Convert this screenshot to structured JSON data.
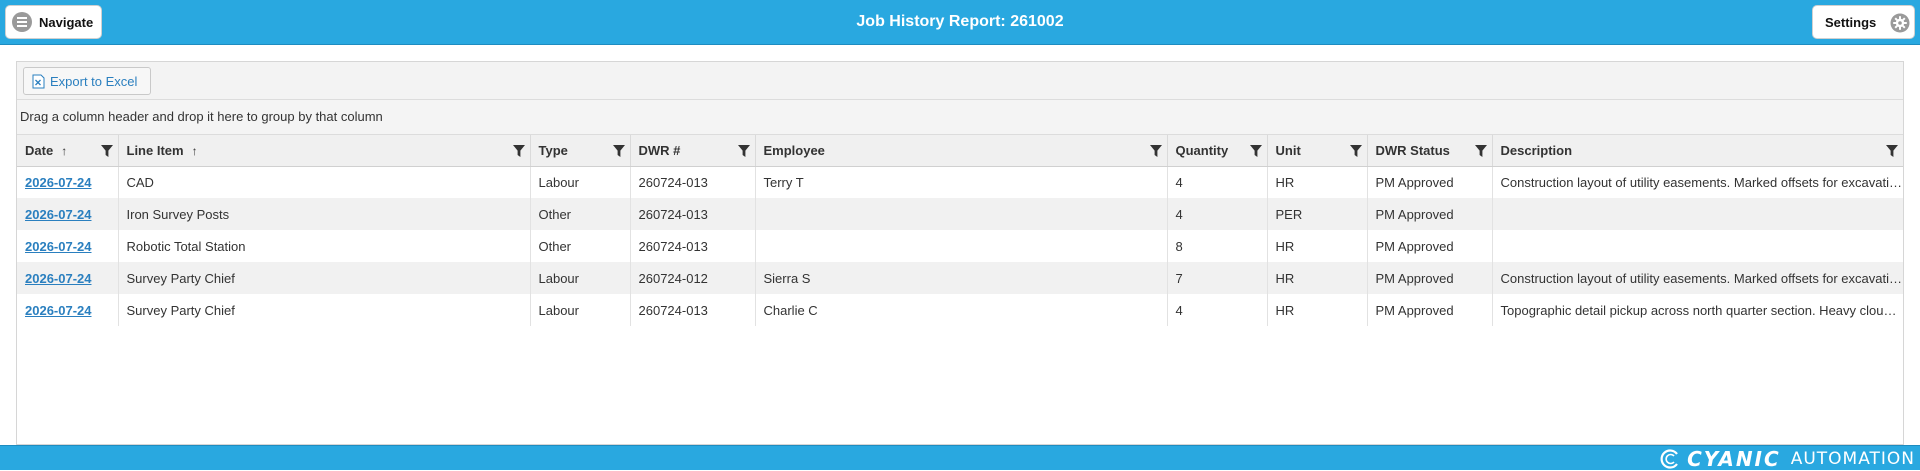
{
  "header": {
    "title": "Job History Report: 261002",
    "navigate_label": "Navigate",
    "settings_label": "Settings"
  },
  "toolbar": {
    "export_label": "Export to Excel"
  },
  "group_hint": "Drag a column header and drop it here to group by that column",
  "columns": [
    {
      "label": "Date",
      "sorted": "asc"
    },
    {
      "label": "Line Item",
      "sorted": "asc"
    },
    {
      "label": "Type"
    },
    {
      "label": "DWR #"
    },
    {
      "label": "Employee"
    },
    {
      "label": "Quantity"
    },
    {
      "label": "Unit"
    },
    {
      "label": "DWR Status"
    },
    {
      "label": "Description"
    }
  ],
  "rows": [
    {
      "date": "2026-07-24",
      "line_item": "CAD",
      "type": "Labour",
      "dwr": "260724-013",
      "employee": "Terry T",
      "quantity": "4",
      "unit": "HR",
      "status": "PM Approved",
      "description": "Construction layout of utility easements. Marked offsets for excavation and verified control points along the corridor."
    },
    {
      "date": "2026-07-24",
      "line_item": "Iron Survey Posts",
      "type": "Other",
      "dwr": "260724-013",
      "employee": "",
      "quantity": "4",
      "unit": "PER",
      "status": "PM Approved",
      "description": ""
    },
    {
      "date": "2026-07-24",
      "line_item": "Robotic Total Station",
      "type": "Other",
      "dwr": "260724-013",
      "employee": "",
      "quantity": "8",
      "unit": "HR",
      "status": "PM Approved",
      "description": ""
    },
    {
      "date": "2026-07-24",
      "line_item": "Survey Party Chief",
      "type": "Labour",
      "dwr": "260724-012",
      "employee": "Sierra S",
      "quantity": "7",
      "unit": "HR",
      "status": "PM Approved",
      "description": "Construction layout of utility easements. Marked offsets for excavation and verified control points along the corridor."
    },
    {
      "date": "2026-07-24",
      "line_item": "Survey Party Chief",
      "type": "Labour",
      "dwr": "260724-013",
      "employee": "Charlie C",
      "quantity": "4",
      "unit": "HR",
      "status": "PM Approved",
      "description": "Topographic detail pickup across north quarter section. Heavy cloud cover in the afternoon."
    }
  ],
  "footer": {
    "brand_word1": "CYANIC",
    "brand_word2": "AUTOMATION"
  },
  "colors": {
    "accent": "#29a8e0",
    "link": "#2a7fbf"
  }
}
